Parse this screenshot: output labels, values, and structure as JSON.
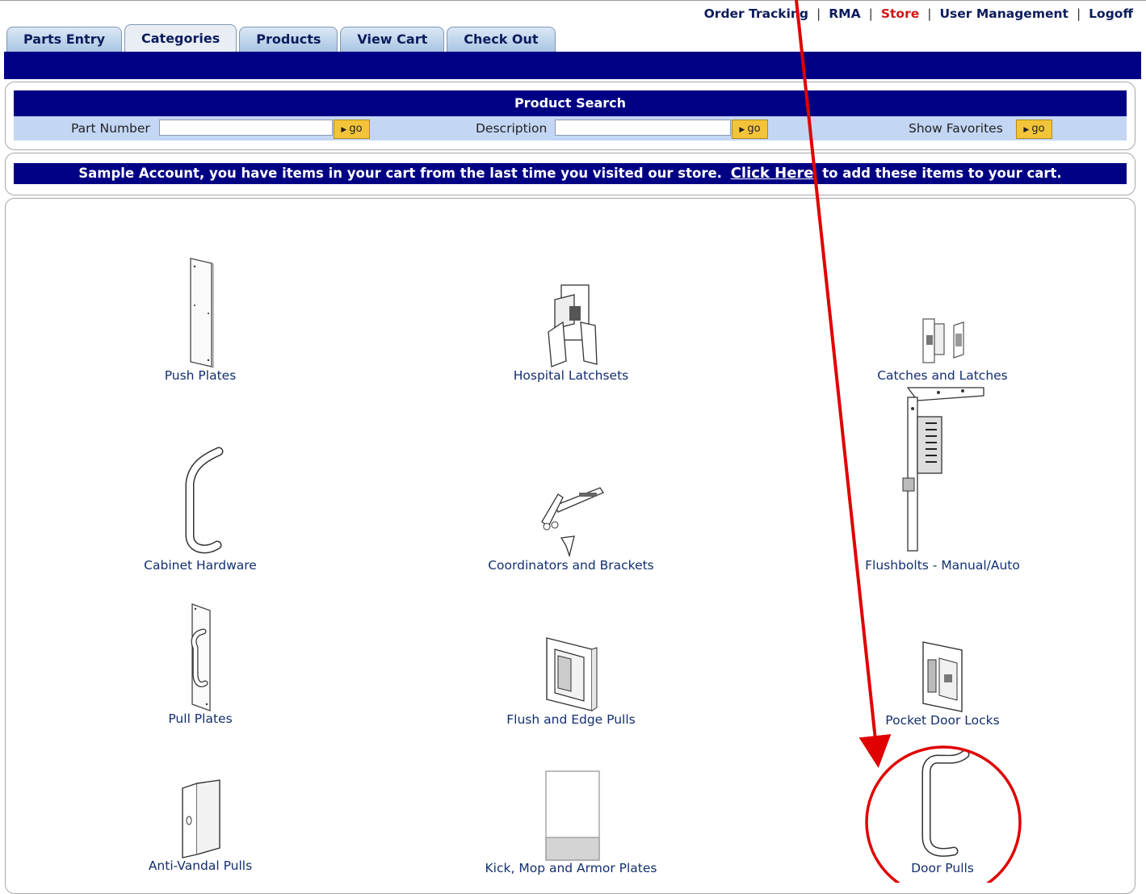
{
  "top_nav": {
    "items": [
      {
        "label": "Order Tracking",
        "active": false
      },
      {
        "label": "RMA",
        "active": false
      },
      {
        "label": "Store",
        "active": true
      },
      {
        "label": "User Management",
        "active": false
      },
      {
        "label": "Logoff",
        "active": false
      }
    ],
    "separator": "|"
  },
  "tabs": [
    {
      "label": "Parts Entry",
      "active": false
    },
    {
      "label": "Categories",
      "active": true
    },
    {
      "label": "Products",
      "active": false
    },
    {
      "label": "View Cart",
      "active": false
    },
    {
      "label": "Check Out",
      "active": false
    }
  ],
  "product_search": {
    "title": "Product Search",
    "part_number_label": "Part Number",
    "part_number_value": "",
    "description_label": "Description",
    "description_value": "",
    "show_favorites_label": "Show Favorites",
    "go_label": "go"
  },
  "cart_notice": {
    "before": "Sample Account, you have items in your cart from the last time you visited our store.",
    "link": "Click Here",
    "after": "to add these items to your cart."
  },
  "categories": [
    {
      "label": "Push Plates",
      "icon": "push-plate-icon"
    },
    {
      "label": "Hospital Latchsets",
      "icon": "hospital-latchset-icon"
    },
    {
      "label": "Catches and Latches",
      "icon": "catch-latch-icon"
    },
    {
      "label": "Cabinet Hardware",
      "icon": "cabinet-hardware-icon"
    },
    {
      "label": "Coordinators and Brackets",
      "icon": "coordinator-bracket-icon"
    },
    {
      "label": "Flushbolts - Manual/Auto",
      "icon": "flushbolt-icon"
    },
    {
      "label": "Pull Plates",
      "icon": "pull-plate-icon"
    },
    {
      "label": "Flush and Edge Pulls",
      "icon": "flush-edge-pull-icon"
    },
    {
      "label": "Pocket Door Locks",
      "icon": "pocket-door-lock-icon"
    },
    {
      "label": "Anti-Vandal Pulls",
      "icon": "anti-vandal-pull-icon"
    },
    {
      "label": "Kick, Mop and Armor Plates",
      "icon": "kick-plate-icon"
    },
    {
      "label": "Door Pulls",
      "icon": "door-pull-icon"
    }
  ],
  "annotation": {
    "color": "#e00000",
    "target": "Door Pulls"
  },
  "colors": {
    "nav_blue": "#000084",
    "search_row": "#c3d6f4",
    "go_button": "#f3c43a",
    "link_text": "#122f6f",
    "active_nav": "#d01515"
  }
}
